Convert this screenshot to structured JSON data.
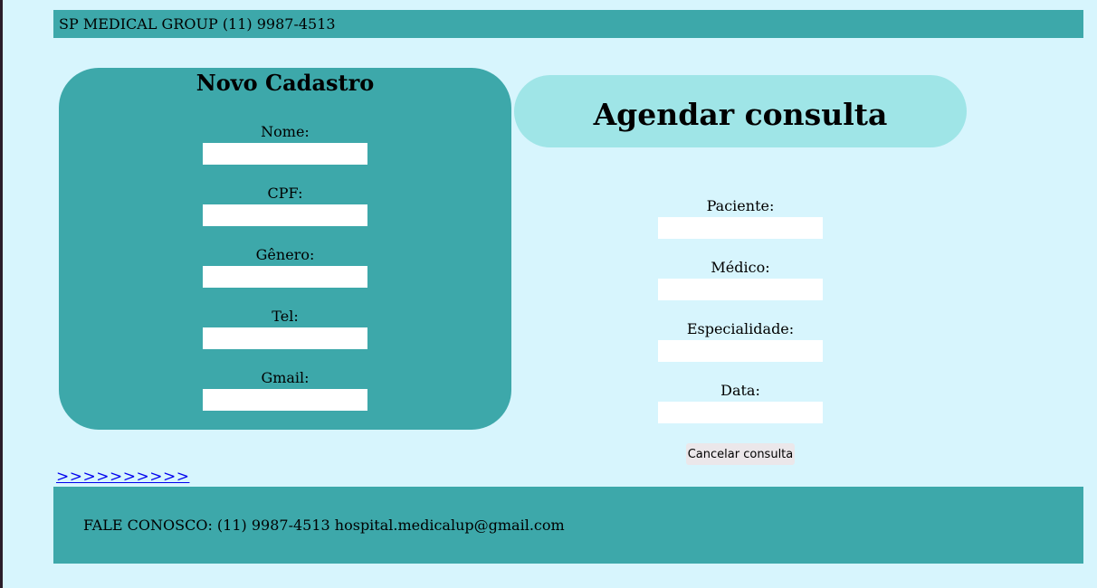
{
  "header": {
    "text": "SP MEDICAL GROUP (11) 9987-4513"
  },
  "register": {
    "title": "Novo Cadastro",
    "fields": [
      {
        "label": "Nome:",
        "value": ""
      },
      {
        "label": "CPF:",
        "value": ""
      },
      {
        "label": "Gênero:",
        "value": ""
      },
      {
        "label": "Tel:",
        "value": ""
      },
      {
        "label": "Gmail:",
        "value": ""
      }
    ]
  },
  "appointment": {
    "title": "Agendar consulta",
    "fields": [
      {
        "label": "Paciente:",
        "value": ""
      },
      {
        "label": "Médico:",
        "value": ""
      },
      {
        "label": "Especialidade:",
        "value": ""
      },
      {
        "label": "Data:",
        "value": ""
      }
    ],
    "cancel_label": "Cancelar consulta"
  },
  "link": {
    "text": ">>>>>>>>>>"
  },
  "footer": {
    "text": "FALE CONOSCO: (11) 9987-4513 hospital.medicalup@gmail.com"
  },
  "colors": {
    "background": "#d7f5fd",
    "teal": "#3da8aa",
    "light_teal": "#9fe5e7"
  }
}
